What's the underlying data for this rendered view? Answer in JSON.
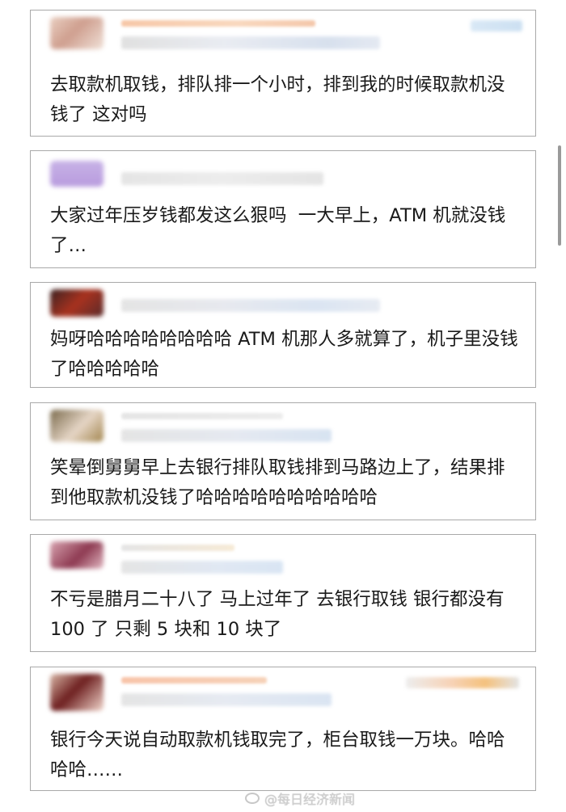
{
  "comments": [
    {
      "text": "去取款机取钱，排队排一个小时，排到我的时候取款机没钱了 这对吗"
    },
    {
      "text": "大家过年压岁钱都发这么狠吗  一大早上，ATM 机就没钱了…"
    },
    {
      "text": "妈呀哈哈哈哈哈哈哈哈 ATM 机那人多就算了，机子里没钱了哈哈哈哈哈"
    },
    {
      "text": "笑晕倒舅舅早上去银行排队取钱排到马路边上了，结果排到他取款机没钱了哈哈哈哈哈哈哈哈哈哈"
    },
    {
      "text": "不亏是腊月二十八了 马上过年了 去银行取钱 银行都没有 100 了 只剩 5 块和 10 块了"
    },
    {
      "text": "银行今天说自动取款机钱取完了，柜台取钱一万块。哈哈哈哈……"
    }
  ],
  "watermark": "@每日经济新闻",
  "icons": {
    "watermark": "weibo-logo-icon"
  }
}
